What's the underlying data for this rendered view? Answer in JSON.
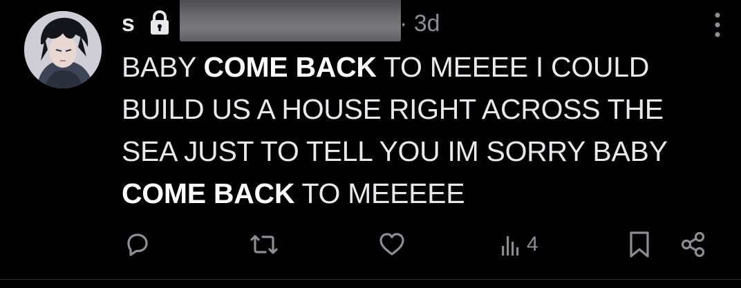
{
  "post": {
    "author": {
      "name": "s",
      "avatar_icon": "avatar-image",
      "lock_icon": "lock-icon"
    },
    "timestamp": "· 3d",
    "text_segments": [
      {
        "text": "BABY ",
        "bold": false
      },
      {
        "text": "COME BACK",
        "bold": true
      },
      {
        "text": " TO MEEEE I COULD BUILD US A HOUSE RIGHT ACROSS THE SEA JUST TO TELL YOU IM SORRY BABY ",
        "bold": false
      },
      {
        "text": "COME BACK",
        "bold": true
      },
      {
        "text": " TO MEEEEE",
        "bold": false
      }
    ],
    "actions": {
      "reply_icon": "reply-icon",
      "repost_icon": "repost-icon",
      "like_icon": "heart-icon",
      "views_icon": "views-icon",
      "views_count": "4",
      "bookmark_icon": "bookmark-icon",
      "share_icon": "share-icon",
      "more_icon": "more-icon"
    },
    "colors": {
      "background": "#000000",
      "text": "#e7e9ea",
      "secondary_text": "#8b8f94"
    }
  }
}
